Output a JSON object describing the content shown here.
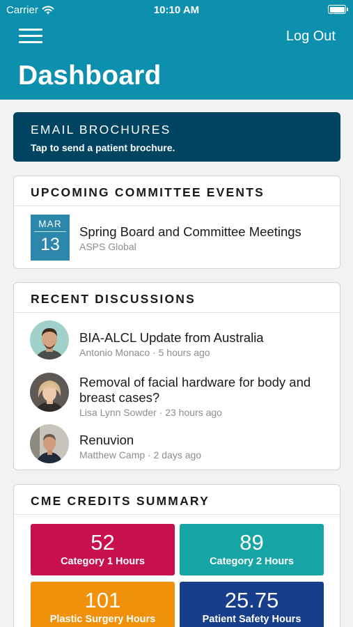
{
  "status_bar": {
    "carrier": "Carrier",
    "time": "10:10 AM"
  },
  "header": {
    "logout_label": "Log Out",
    "title": "Dashboard",
    "background_color": "#0d8fae"
  },
  "email_card": {
    "title": "EMAIL BROCHURES",
    "subtitle": "Tap to send a patient brochure."
  },
  "events": {
    "title": "UPCOMING COMMITTEE EVENTS",
    "items": [
      {
        "month": "MAR",
        "day": "13",
        "title": "Spring Board and Committee Meetings",
        "organizer": "ASPS Global"
      }
    ]
  },
  "discussions": {
    "title": "RECENT DISCUSSIONS",
    "items": [
      {
        "title": "BIA-ALCL Update from Australia",
        "meta": "Antonio Monaco · 5 hours ago"
      },
      {
        "title": "Removal of facial hardware for body and breast cases?",
        "meta": "Lisa Lynn Sowder · 23 hours ago"
      },
      {
        "title": "Renuvion",
        "meta": "Matthew Camp · 2 days ago"
      }
    ]
  },
  "cme": {
    "title": "CME CREDITS SUMMARY",
    "tiles": [
      {
        "value": "52",
        "label": "Category 1 Hours",
        "color": "#c8104f"
      },
      {
        "value": "89",
        "label": "Category 2 Hours",
        "color": "#17a5a5"
      },
      {
        "value": "101",
        "label": "Plastic Surgery Hours",
        "color": "#f1900a"
      },
      {
        "value": "25.75",
        "label": "Patient Safety Hours",
        "color": "#173e8a"
      }
    ]
  }
}
